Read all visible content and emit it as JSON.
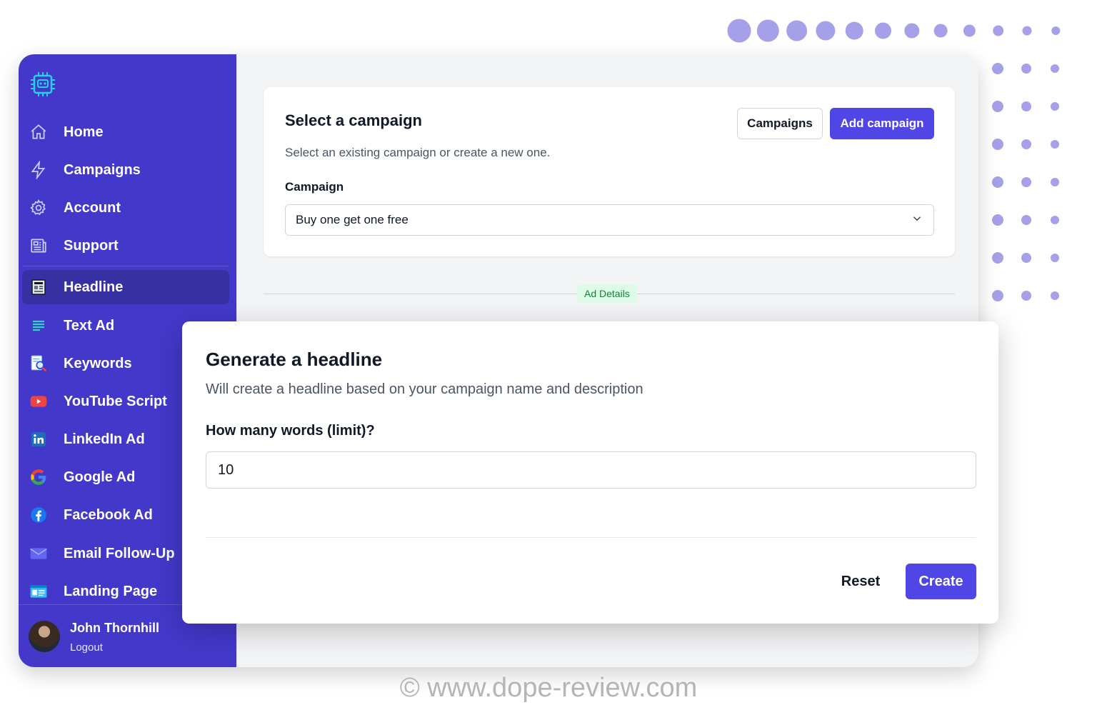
{
  "colors": {
    "sidebar": "#4338ca",
    "sidebar_active": "#3730a3",
    "primary": "#4f46e5",
    "dots": "#a5a0e8",
    "badge_bg": "#dcfce7",
    "badge_text": "#15803d"
  },
  "sidebar": {
    "logo_icon": "cpu-robot-icon",
    "items": [
      {
        "label": "Home",
        "icon": "home-icon"
      },
      {
        "label": "Campaigns",
        "icon": "lightning-icon"
      },
      {
        "label": "Account",
        "icon": "gear-icon"
      },
      {
        "label": "Support",
        "icon": "newspaper-icon"
      },
      {
        "label": "Headline",
        "icon": "headline-icon",
        "active": true
      },
      {
        "label": "Text Ad",
        "icon": "text-lines-icon"
      },
      {
        "label": "Keywords",
        "icon": "keyword-search-icon"
      },
      {
        "label": "YouTube Script",
        "icon": "youtube-icon"
      },
      {
        "label": "LinkedIn Ad",
        "icon": "linkedin-icon"
      },
      {
        "label": "Google Ad",
        "icon": "google-icon"
      },
      {
        "label": "Facebook Ad",
        "icon": "facebook-icon"
      },
      {
        "label": "Email Follow-Up",
        "icon": "envelope-icon"
      },
      {
        "label": "Landing Page",
        "icon": "browser-window-icon"
      }
    ],
    "user": {
      "name": "John Thornhill",
      "logout_label": "Logout"
    }
  },
  "campaign_card": {
    "title": "Select a campaign",
    "description": "Select an existing campaign or create a new one.",
    "campaigns_button": "Campaigns",
    "add_button": "Add campaign",
    "field_label": "Campaign",
    "selected_campaign": "Buy one get one free"
  },
  "separator_badge": "Ad Details",
  "headline_modal": {
    "title": "Generate a headline",
    "description": "Will create a headline based on your campaign name and description",
    "field_label": "How many words (limit)?",
    "field_value": "10",
    "reset_label": "Reset",
    "create_label": "Create"
  },
  "watermark": "© www.dope-review.com"
}
